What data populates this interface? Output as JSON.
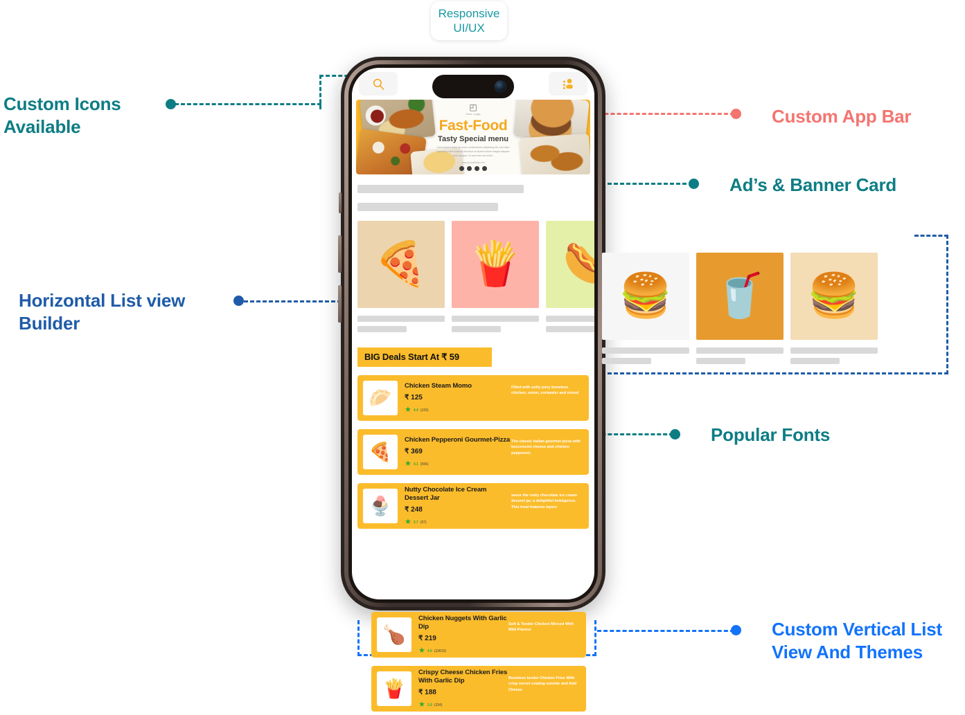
{
  "callout_pill": {
    "text": "Responsive\nUI/UX",
    "color": "#1899a3"
  },
  "annotations": [
    {
      "name": "custom-icons",
      "text": "Custom Icons\nAvailable",
      "color": "#0d7d84"
    },
    {
      "name": "custom-app-bar",
      "text": "Custom App Bar",
      "color": "#f4756f"
    },
    {
      "name": "ads-banner-card",
      "text": "Ad’s & Banner Card",
      "color": "#0d7d84"
    },
    {
      "name": "horizontal-list",
      "text": "Horizontal List view\nBuilder",
      "color": "#1f5ba8"
    },
    {
      "name": "popular-fonts",
      "text": "Popular Fonts",
      "color": "#0d7d84"
    },
    {
      "name": "vertical-list",
      "text": "Custom Vertical List\nView And Themes",
      "color": "#1273fb"
    }
  ],
  "app": {
    "appbar": {
      "search_icon": "search-icon",
      "profile_icon": "user-account-icon",
      "icon_color": "#f5a623"
    },
    "banner": {
      "logo_mark": "◰",
      "logo_text": "Your Logo",
      "title": "Fast-Food",
      "subtitle": "Tasty Special menu",
      "body": "Lorem ipsum dolor sit amet, consectetuer adipiscing elit, sed diam nonummy nibh euismod tincidunt ut laoreet dolore magna aliquam erat volutpat. Ut wisi enim ad minim.",
      "website": "www.yourwebsite.com",
      "socials": [
        "whatsapp-icon",
        "twitter-icon",
        "instagram-icon",
        "facebook-icon"
      ]
    },
    "horizontal_cards": [
      {
        "name": "pizza",
        "emoji": "🍕",
        "bg": "#ecd4ae"
      },
      {
        "name": "french-fries",
        "emoji": "🍟",
        "bg": "#feb3a8"
      },
      {
        "name": "hot-dog",
        "emoji": "🌭",
        "bg": "#e4efa8"
      },
      {
        "name": "hamburger",
        "emoji": "🍔",
        "bg": "#f6f6f6"
      },
      {
        "name": "cola-drink",
        "emoji": "🥤",
        "bg": "#e79b2f"
      },
      {
        "name": "burger-combo",
        "emoji": "🍔",
        "bg": "#f4dcb4"
      }
    ],
    "deals_banner": {
      "text": "BIG Deals Start At ₹ 59",
      "bg": "#fbbc2c"
    },
    "food_items": [
      {
        "name": "chicken-steam-momo",
        "emoji": "🥟",
        "title": "Chicken Steam Momo",
        "price": "₹ 125",
        "rating": "4.4",
        "rating_count": "(193)",
        "desc": "Filled with softy juicy boneless chicken, onion, coriander and mixed"
      },
      {
        "name": "chicken-pepperoni-gourmet-pizza",
        "emoji": "🍕",
        "title": "Chicken Pepperoni Gourmet-Pizza",
        "price": "₹  369",
        "rating": "4.1",
        "rating_count": "(506)",
        "desc": "The classic italian gourmet pizza with bocconcini cheese and chicken pepperoni."
      },
      {
        "name": "nutty-chocolate-ice-cream-dessert-jar",
        "emoji": "🍨",
        "title": "Nutty Chocolate Ice Cream Dessert Jar",
        "price": "₹  248",
        "rating": "3.7",
        "rating_count": "(57)",
        "desc": "savor the nutty chocolate ice cream dessert jar, a delightful indulgence. This treat features layers"
      },
      {
        "name": "chicken-nuggets-with-garlic-dip",
        "emoji": "🍗",
        "title": "Chicken Nuggets With Garlic Dip",
        "price": "₹  219",
        "rating": "4.0",
        "rating_count": "(10633)",
        "desc": "Soft & Tender Chicken Minced With Mild Flavour"
      },
      {
        "name": "crispy-cheese-chicken-fries-with-garlic-dip",
        "emoji": "🍟",
        "title": "Crispy Cheese Chicken Fries With Garlic Dip",
        "price": "₹  188",
        "rating": "3.9",
        "rating_count": "(334)",
        "desc": "Boneless tender Chicken Fries With crisp secret coating outside and Add Cheese"
      }
    ]
  }
}
